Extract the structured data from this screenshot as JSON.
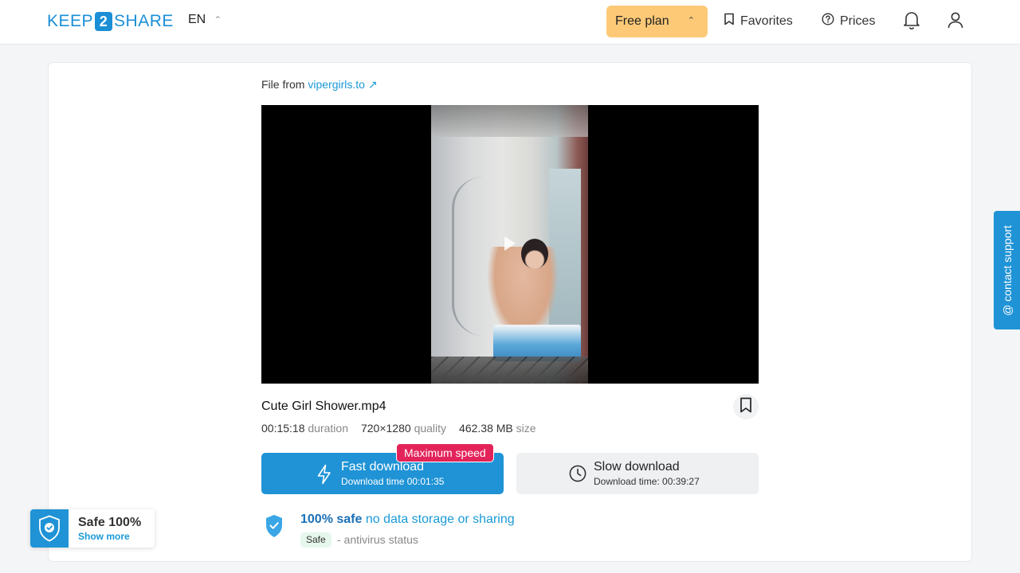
{
  "header": {
    "logo_left": "KEEP",
    "logo_mid": "2",
    "logo_right": "SHARE",
    "language": "EN",
    "plan_label": "Free plan",
    "favorites_label": "Favorites",
    "prices_label": "Prices"
  },
  "file": {
    "from_prefix": "File from",
    "from_link": "vipergirls.to",
    "name": "Cute Girl Shower.mp4",
    "duration_value": "00:15:18",
    "duration_label": "duration",
    "quality_value": "720×1280",
    "quality_label": "quality",
    "size_value": "462.38 MB",
    "size_label": "size"
  },
  "download": {
    "fast_title": "Fast download",
    "fast_sub": "Download time 00:01:35",
    "badge": "Maximum speed",
    "slow_title": "Slow download",
    "slow_sub": "Download time: 00:39:27"
  },
  "safety": {
    "strong": "100% safe",
    "rest": "no data storage or sharing",
    "pill": "Safe",
    "status": "- antivirus status"
  },
  "widget": {
    "title": "Safe 100%",
    "link": "Show more"
  },
  "support": {
    "label": "@ contact support"
  },
  "colors": {
    "brand": "#1f93d6",
    "plan": "#fdc977",
    "badge": "#e3245a"
  }
}
